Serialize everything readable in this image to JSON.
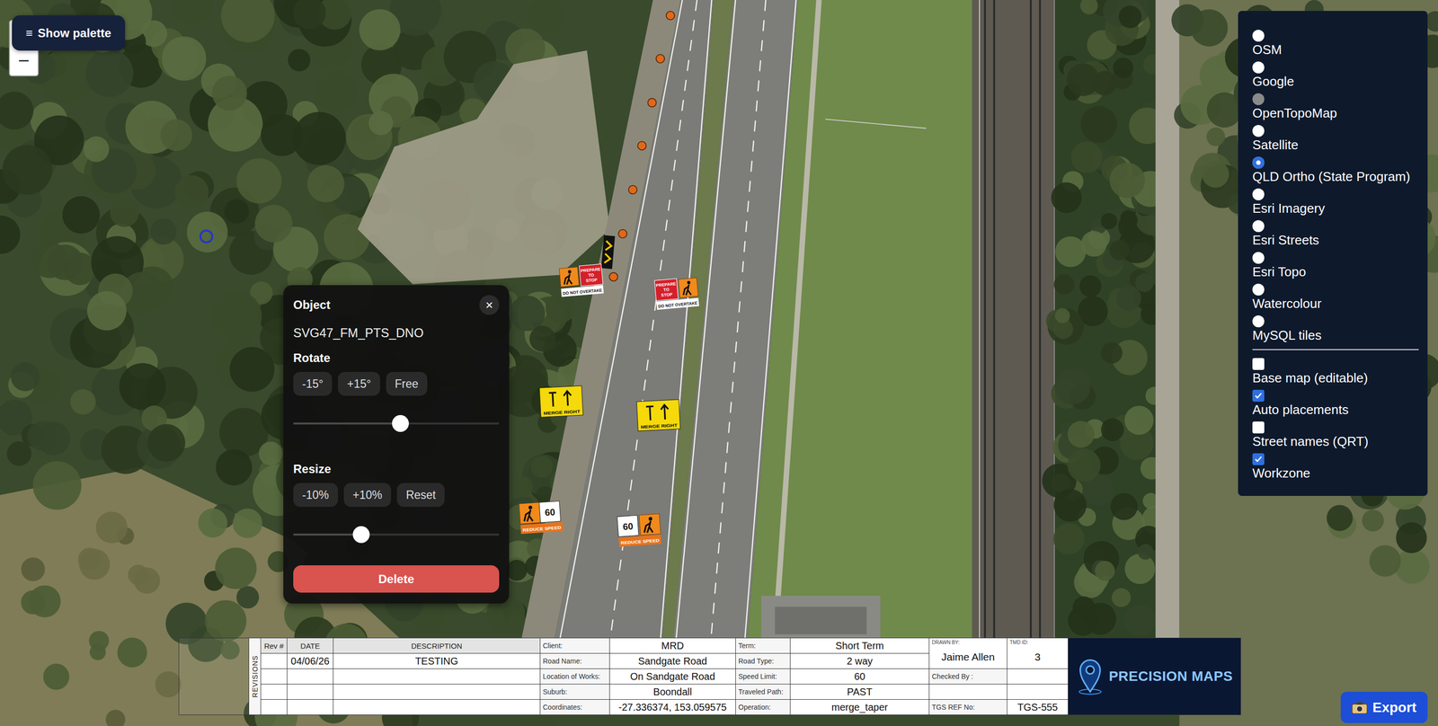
{
  "palette_button": {
    "icon": "≡",
    "label": "Show palette"
  },
  "zoom": {
    "out": "−"
  },
  "map": {
    "signs": [
      {
        "kind": "pts",
        "board_lines": [
          "PREPARE",
          "TO",
          "STOP"
        ],
        "caption": "DO NOT OVERTAKE"
      },
      {
        "kind": "pts",
        "board_lines": [
          "PREPARE",
          "TO",
          "STOP"
        ],
        "caption": "DO NOT OVERTAKE"
      },
      {
        "kind": "merge",
        "caption": "MERGE RIGHT"
      },
      {
        "kind": "merge",
        "caption": "MERGE RIGHT"
      },
      {
        "kind": "speed",
        "speed": "60",
        "caption": "REDUCE SPEED"
      },
      {
        "kind": "speed",
        "speed": "60",
        "caption": "REDUCE SPEED"
      }
    ]
  },
  "object_panel": {
    "title": "Object",
    "close": "×",
    "object_name": "SVG47_FM_PTS_DNO",
    "rotate": {
      "label": "Rotate",
      "buttons": [
        "-15°",
        "+15°",
        "Free"
      ],
      "level": 0.52
    },
    "resize": {
      "label": "Resize",
      "buttons": [
        "-10%",
        "+10%",
        "Reset"
      ],
      "level": 0.33
    },
    "delete": "Delete"
  },
  "layers": {
    "base_layers": [
      {
        "label": "OSM",
        "selected": false,
        "disabled": false
      },
      {
        "label": "Google",
        "selected": false,
        "disabled": false
      },
      {
        "label": "OpenTopoMap",
        "selected": false,
        "disabled": true
      },
      {
        "label": "Satellite",
        "selected": false,
        "disabled": false
      },
      {
        "label": "QLD Ortho (State Program)",
        "selected": true,
        "disabled": false
      },
      {
        "label": "Esri Imagery",
        "selected": false,
        "disabled": false
      },
      {
        "label": "Esri Streets",
        "selected": false,
        "disabled": false
      },
      {
        "label": "Esri Topo",
        "selected": false,
        "disabled": false
      },
      {
        "label": "Watercolour",
        "selected": false,
        "disabled": false
      },
      {
        "label": "MySQL tiles",
        "selected": false,
        "disabled": false
      }
    ],
    "overlays": [
      {
        "label": "Base map (editable)",
        "checked": false
      },
      {
        "label": "Auto placements",
        "checked": true
      },
      {
        "label": "Street names (QRT)",
        "checked": false
      },
      {
        "label": "Workzone",
        "checked": true
      }
    ]
  },
  "title_block": {
    "revisions_label": "REVISIONS",
    "revision_columns": [
      "Rev #",
      "DATE",
      "DESCRIPTION"
    ],
    "revision_rows": [
      [
        "",
        "04/06/26",
        "TESTING"
      ],
      [
        "",
        "",
        ""
      ],
      [
        "",
        "",
        ""
      ],
      [
        "",
        "",
        ""
      ]
    ],
    "project": [
      {
        "label": "Client:",
        "value": "MRD"
      },
      {
        "label": "Road Name:",
        "value": "Sandgate Road"
      },
      {
        "label": "Location of Works:",
        "value": "On Sandgate Road"
      },
      {
        "label": "Suburb:",
        "value": "Boondall"
      },
      {
        "label": "Coordinates:",
        "value": "-27.336374, 153.059575"
      }
    ],
    "traffic": [
      {
        "label": "Term:",
        "value": "Short Term"
      },
      {
        "label": "Road Type:",
        "value": "2 way"
      },
      {
        "label": "Speed Limit:",
        "value": "60"
      },
      {
        "label": "Traveled Path:",
        "value": "PAST"
      },
      {
        "label": "Operation:",
        "value": "merge_taper"
      }
    ],
    "drawn_by": {
      "label": "DRAWN BY:",
      "value": "Jaime Allen"
    },
    "tmd_id": {
      "label": "TMD ID:",
      "value": "3"
    },
    "checked_by": {
      "label": "Checked By :",
      "value": ""
    },
    "tgs_ref": {
      "label": "TGS REF No:",
      "value": "TGS-555"
    },
    "logo": "PRECISION MAPS"
  },
  "export_button": {
    "label": "Export"
  }
}
